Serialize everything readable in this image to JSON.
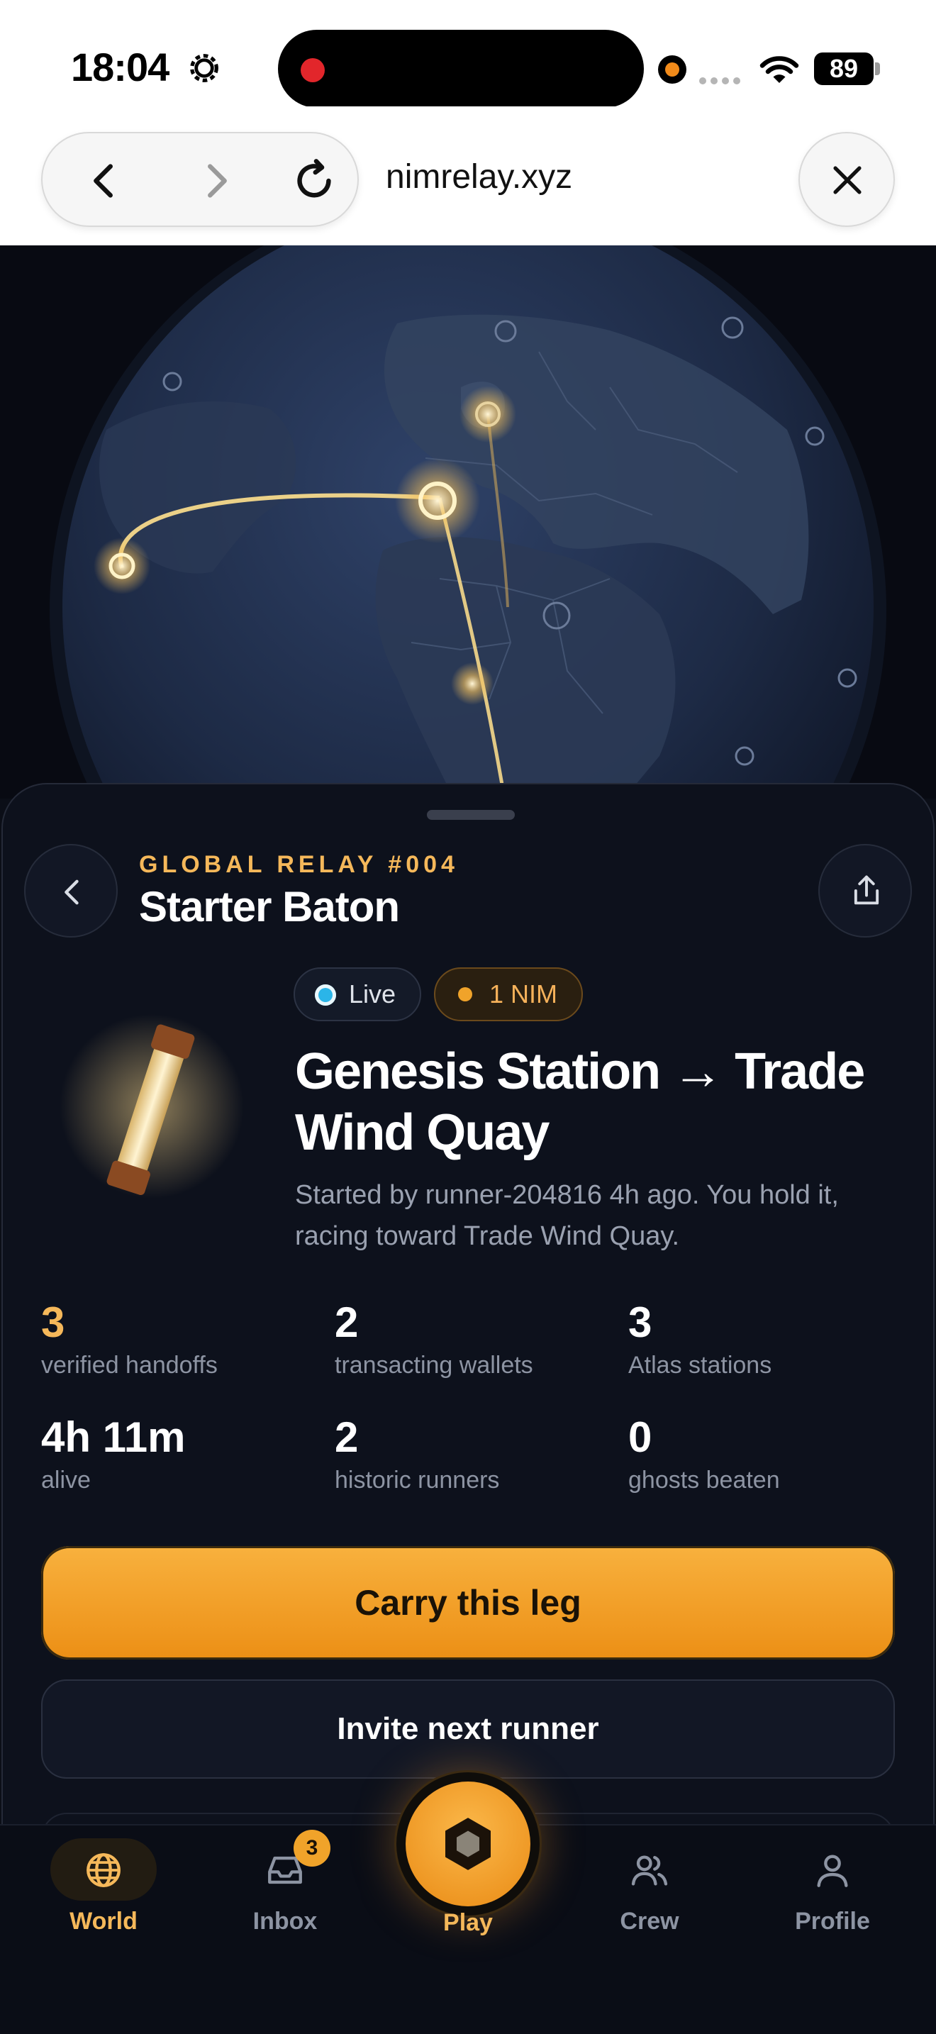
{
  "status_bar": {
    "time": "18:04",
    "battery": "89"
  },
  "browser": {
    "url": "nimrelay.xyz"
  },
  "relay": {
    "eyebrow": "GLOBAL RELAY #004",
    "title": "Starter Baton",
    "badges": {
      "live": "Live",
      "stake": "1 NIM"
    },
    "route": "Genesis Station → Trade Wind Quay",
    "description": "Started by runner-204816 4h ago. You hold it, racing toward Trade Wind Quay.",
    "stats": [
      {
        "value": "3",
        "label": "verified handoffs"
      },
      {
        "value": "2",
        "label": "transacting wallets"
      },
      {
        "value": "3",
        "label": "Atlas stations"
      },
      {
        "value": "4h 11m",
        "label": "alive"
      },
      {
        "value": "2",
        "label": "historic runners"
      },
      {
        "value": "0",
        "label": "ghosts beaten"
      }
    ],
    "primary_action": "Carry this leg",
    "secondary_action": "Invite next runner"
  },
  "tabs": [
    {
      "label": "World",
      "icon": "globe-icon",
      "active": true
    },
    {
      "label": "Inbox",
      "icon": "inbox-icon",
      "badge": "3"
    },
    {
      "label": "Play",
      "icon": "hexagon-icon"
    },
    {
      "label": "Crew",
      "icon": "users-icon"
    },
    {
      "label": "Profile",
      "icon": "user-icon"
    }
  ],
  "colors": {
    "accent": "#f5b85a",
    "cta": "#f0a32a",
    "live": "#2bb5e8",
    "background": "#0d111c"
  }
}
